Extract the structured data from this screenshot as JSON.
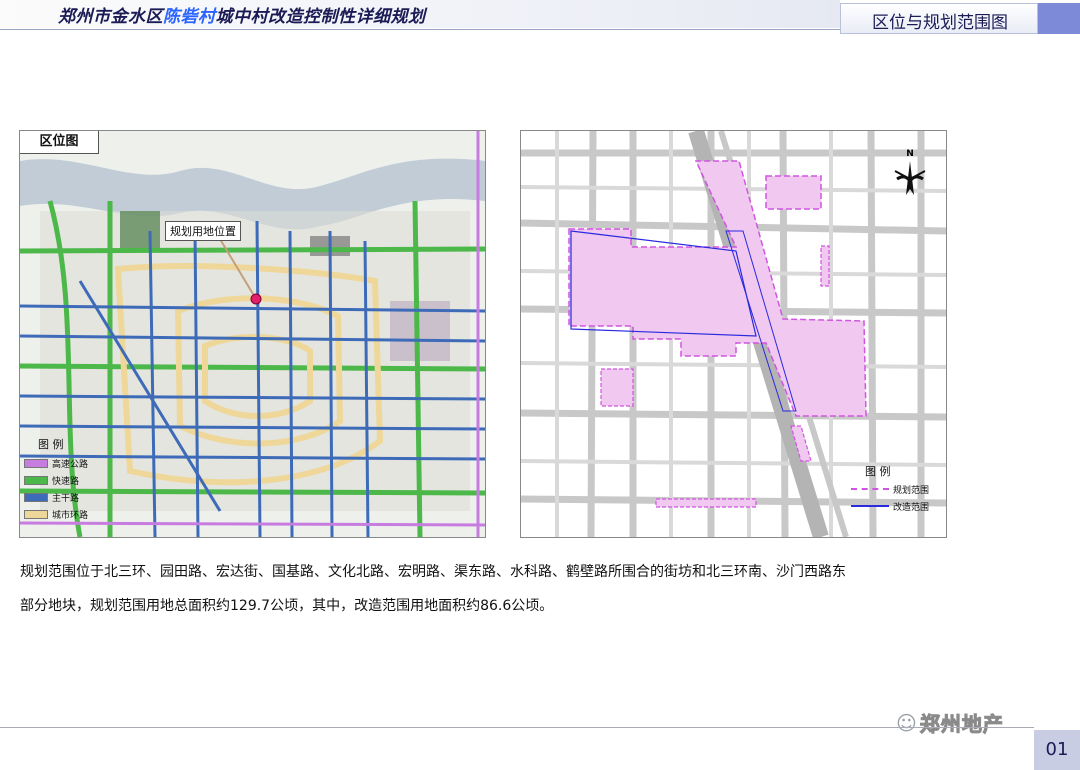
{
  "header": {
    "title_pre": "郑州市金水区",
    "title_hl": "陈砦村",
    "title_post": "城中村改造控制性详细规划",
    "section_title": "区位与规划范围图"
  },
  "location_map": {
    "label": "区位图",
    "site_label": "规划用地位置",
    "legend_title": "图 例",
    "legend": [
      {
        "label": "高速公路",
        "color": "#c77ce0"
      },
      {
        "label": "快速路",
        "color": "#4cb84a"
      },
      {
        "label": "主干路",
        "color": "#3e6bb8"
      },
      {
        "label": "城市环路",
        "color": "#efd79a"
      }
    ]
  },
  "plan_map": {
    "north": "N",
    "legend_title": "图 例",
    "legend": [
      {
        "label": "规划范围",
        "color": "#d055e0"
      },
      {
        "label": "改造范围",
        "color": "#2a2adf"
      }
    ]
  },
  "description": [
    "规划范围位于北三环、园田路、宏达街、国基路、文化北路、宏明路、渠东路、水科路、鹤壁路所围合的街坊和北三环南、沙门西路东",
    "部分地块，规划范围用地总面积约129.7公顷，其中，改造范围用地面积约86.6公顷。"
  ],
  "watermark": "郑州地产",
  "page_number": "01"
}
